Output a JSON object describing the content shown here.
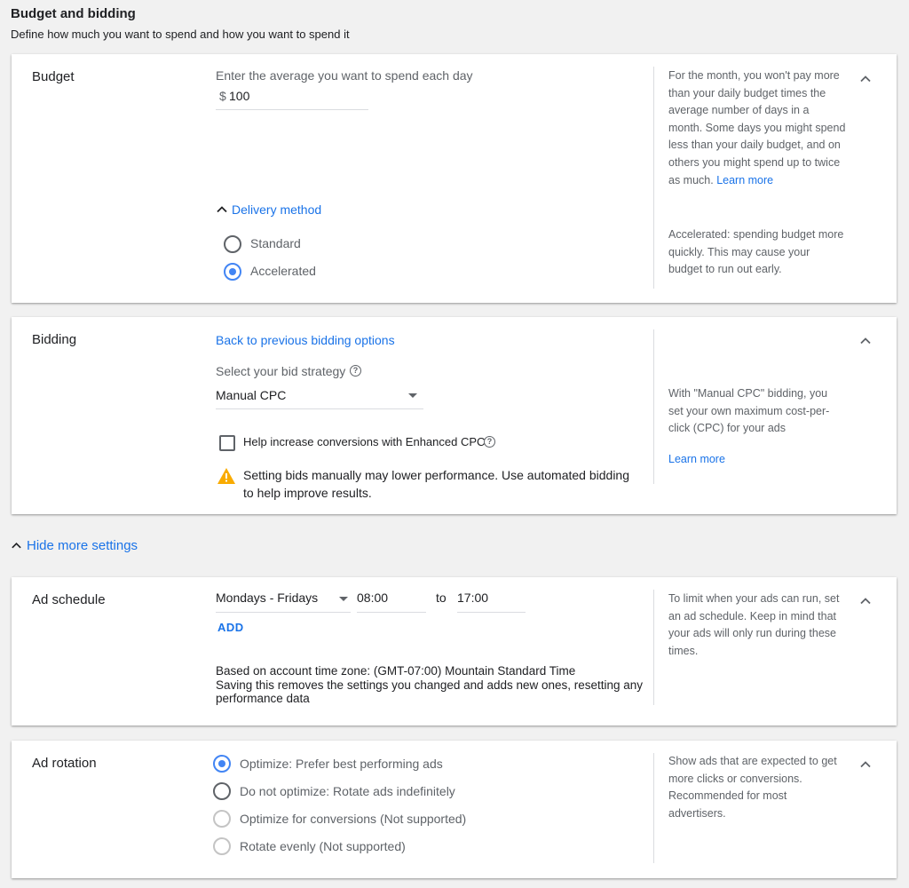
{
  "header": {
    "title": "Budget and bidding",
    "subtitle": "Define how much you want to spend and how you want to spend it"
  },
  "budget": {
    "label": "Budget",
    "prompt": "Enter the average you want to spend each day",
    "currency": "$",
    "amount": "100",
    "help": "For the month, you won't pay more than your daily budget times the average number of days in a month. Some days you might spend less than your daily budget, and on others you might spend up to twice as much.",
    "help_link": "Learn more",
    "delivery_toggle": "Delivery method",
    "delivery_options": [
      "Standard",
      "Accelerated"
    ],
    "delivery_selected": "Accelerated",
    "delivery_help": "Accelerated: spending budget more quickly. This may cause your budget to run out early."
  },
  "bidding": {
    "label": "Bidding",
    "back_link": "Back to previous bidding options",
    "strategy_prompt": "Select your bid strategy",
    "strategy_value": "Manual CPC",
    "ecpc_label": "Help increase conversions with Enhanced CPC",
    "warning": "Setting bids manually may lower performance. Use automated bidding to help improve results.",
    "help": "With \"Manual CPC\" bidding, you set your own maximum cost-per-click (CPC) for your ads",
    "help_link": "Learn more"
  },
  "more_settings": {
    "toggle": "Hide more settings"
  },
  "ad_schedule": {
    "label": "Ad schedule",
    "days": "Mondays - Fridays",
    "start": "08:00",
    "to": "to",
    "end": "17:00",
    "add": "ADD",
    "timezone_note": "Based on account time zone: (GMT-07:00) Mountain Standard Time",
    "reset_note": "Saving this removes the settings you changed and adds new ones, resetting any performance data",
    "help": "To limit when your ads can run, set an ad schedule. Keep in mind that your ads will only run during these times."
  },
  "ad_rotation": {
    "label": "Ad rotation",
    "options": [
      "Optimize: Prefer best performing ads",
      "Do not optimize: Rotate ads indefinitely",
      "Optimize for conversions (Not supported)",
      "Rotate evenly (Not supported)"
    ],
    "selected": "Optimize: Prefer best performing ads",
    "help": "Show ads that are expected to get more clicks or conversions. Recommended for most advertisers."
  },
  "colors": {
    "accent": "#1a73e8",
    "radio": "#4285f4",
    "warning": "#f9ab00"
  }
}
